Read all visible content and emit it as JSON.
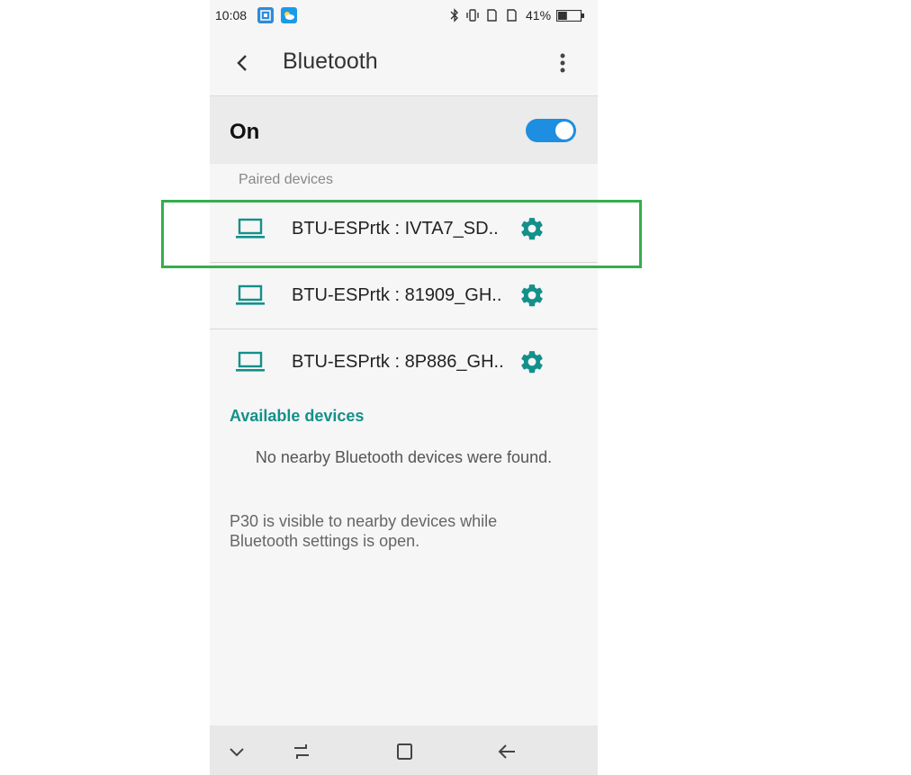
{
  "status_bar": {
    "time": "10:08",
    "battery_percent": "41%",
    "battery_level": 0.41
  },
  "toolbar": {
    "title": "Bluetooth"
  },
  "bluetooth_toggle": {
    "label": "On",
    "state": true,
    "accent_color": "#1e8ee0"
  },
  "paired": {
    "header": "Paired devices",
    "devices": [
      {
        "name": "BTU-ESPrtk : IVTA7_SD.."
      },
      {
        "name": "BTU-ESPrtk : 81909_GH.."
      },
      {
        "name": "BTU-ESPrtk : 8P886_GH.."
      }
    ]
  },
  "available": {
    "header": "Available devices",
    "empty_message": "No nearby Bluetooth devices were found."
  },
  "visibility_note": "P30 is visible to nearby devices while Bluetooth settings is open.",
  "colors": {
    "teal": "#14908a",
    "highlight": "#36ad4e"
  }
}
